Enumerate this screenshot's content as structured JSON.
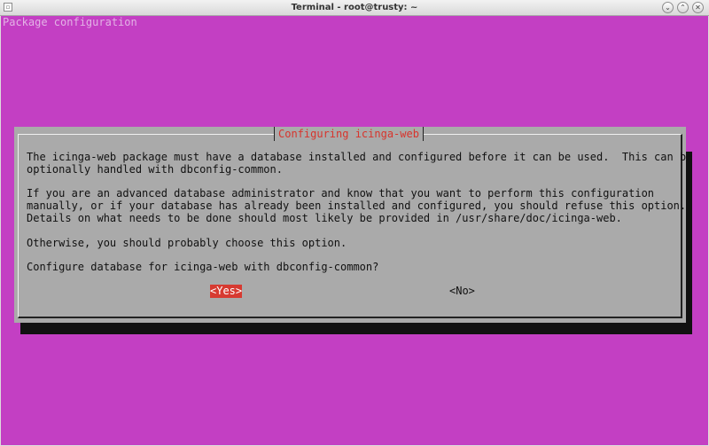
{
  "window": {
    "title": "Terminal - root@trusty: ~",
    "buttons": {
      "minimize": "⌄",
      "maximize": "⌃",
      "close": "✕"
    }
  },
  "terminal": {
    "backtitle": "Package configuration"
  },
  "dialog": {
    "title": "Configuring icinga-web",
    "paragraphs": [
      "The icinga-web package must have a database installed and configured before it can be used.  This can be\noptionally handled with dbconfig-common.",
      "If you are an advanced database administrator and know that you want to perform this configuration\nmanually, or if your database has already been installed and configured, you should refuse this option.\nDetails on what needs to be done should most likely be provided in /usr/share/doc/icinga-web.",
      "Otherwise, you should probably choose this option.",
      "Configure database for icinga-web with dbconfig-common?"
    ],
    "yes_label": "<Yes>",
    "no_label": "<No>"
  },
  "colors": {
    "terminal_bg": "#c33fc3",
    "dialog_bg": "#aaaaaa",
    "title_text": "#d8342c",
    "selected_button_bg": "#d73a31"
  }
}
